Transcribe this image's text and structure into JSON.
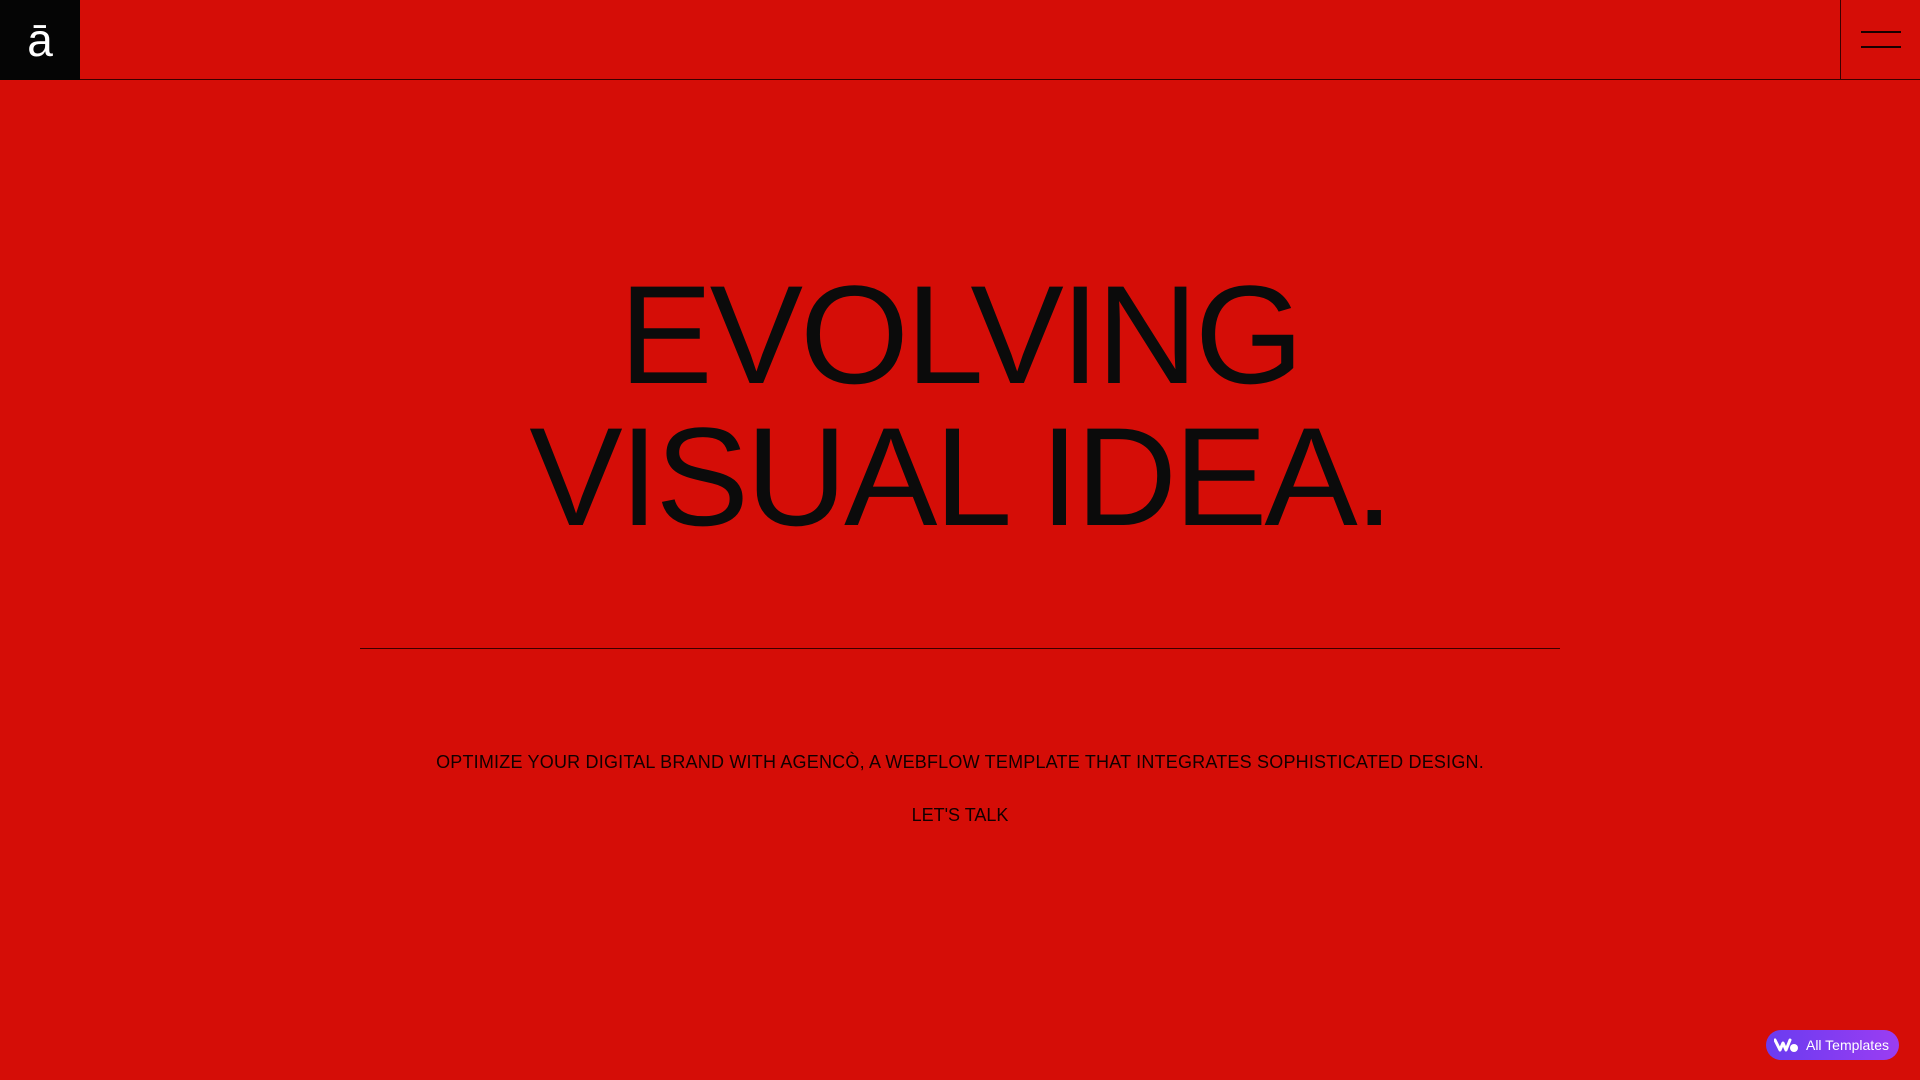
{
  "header": {
    "logo_text": "ā",
    "menu_icon": "hamburger-menu-icon"
  },
  "hero": {
    "line1": "EVOLVING",
    "line2": "VISUAL IDEA."
  },
  "tagline": "OPTIMIZE YOUR DIGITAL BRAND WITH AGENCÒ, A WEBFLOW TEMPLATE THAT INTEGRATES SOPHISTICATED DESIGN.",
  "cta": {
    "label": "LET'S TALK"
  },
  "badge": {
    "icon": "webflow-logo-icon",
    "label": "All Templates"
  },
  "colors": {
    "background": "#d50d07",
    "logo_bg": "#050505",
    "badge_gradient_start": "#6a3cf0",
    "badge_gradient_end": "#9b3df2"
  }
}
